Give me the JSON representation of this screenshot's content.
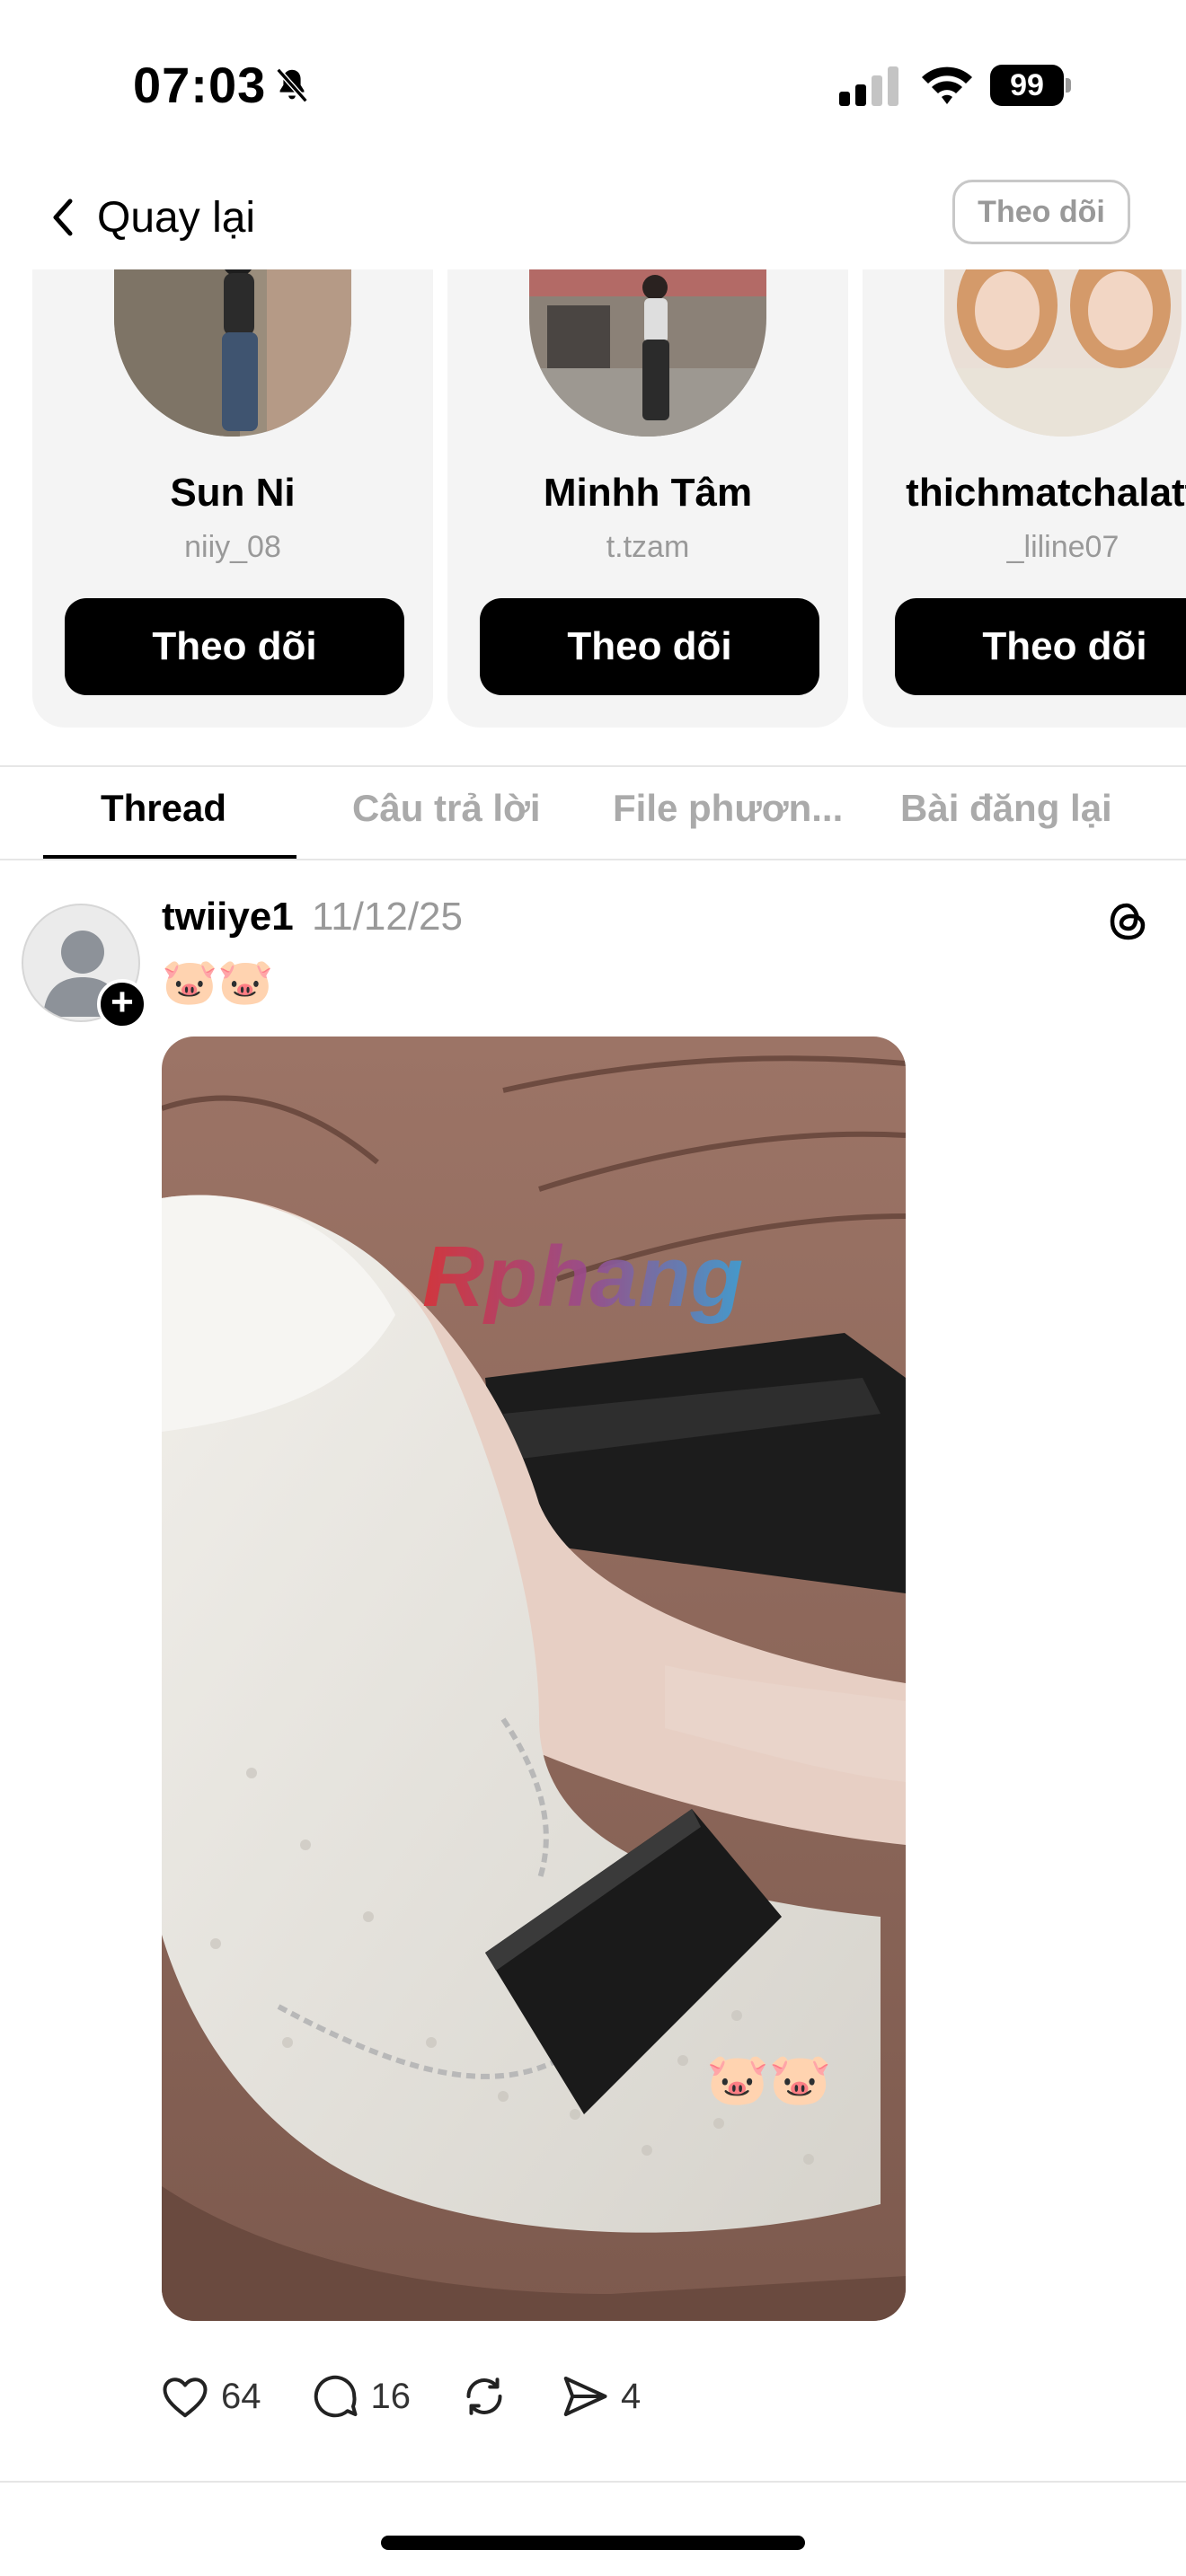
{
  "status_bar": {
    "time": "07:03",
    "battery": "99",
    "icons": [
      "bell-slash-icon",
      "signal-icon",
      "wifi-icon",
      "battery-icon"
    ]
  },
  "header": {
    "back_label": "Quay lại",
    "follow_label": "Theo dõi"
  },
  "suggestions": [
    {
      "name": "Sun Ni",
      "handle": "niiy_08",
      "button": "Theo dõi"
    },
    {
      "name": "Minhh Tâm",
      "handle": "t.tzam",
      "button": "Theo dõi"
    },
    {
      "name": "thichmatchalatte",
      "handle": "_liline07",
      "button": "Theo dõi"
    }
  ],
  "tabs": [
    {
      "label": "Thread",
      "active": true
    },
    {
      "label": "Câu trả lời",
      "active": false
    },
    {
      "label": "File phươn...",
      "active": false
    },
    {
      "label": "Bài đăng lại",
      "active": false
    }
  ],
  "post": {
    "username": "twiiye1",
    "date": "11/12/25",
    "text": "🐷🐷",
    "image_watermark": "Rphang",
    "image_sticker": "🐷🐷",
    "likes": "64",
    "comments": "16",
    "shares": "4"
  },
  "colors": {
    "accent": "#000000",
    "muted": "#999999",
    "card_bg": "#f4f4f4"
  }
}
